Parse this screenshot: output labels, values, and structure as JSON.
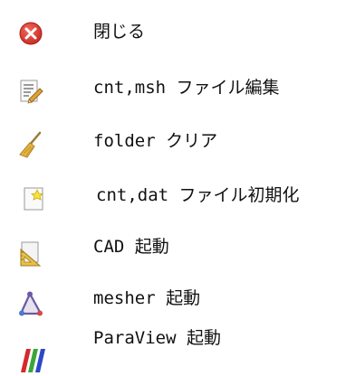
{
  "menu": {
    "items": [
      {
        "icon": "close-icon",
        "label": "閉じる"
      },
      {
        "icon": "edit-document-icon",
        "label": "cnt,msh ファイル編集"
      },
      {
        "icon": "broom-icon",
        "label": "folder クリア"
      },
      {
        "icon": "new-document-icon",
        "label": "cnt,dat ファイル初期化"
      },
      {
        "icon": "cad-drafting-icon",
        "label": "CAD 起動"
      },
      {
        "icon": "mesher-triangle-icon",
        "label": "mesher 起動"
      },
      {
        "icon": "paraview-icon",
        "label": "ParaView 起動"
      }
    ]
  },
  "colors": {
    "close_red": "#d9302a",
    "paraview_red": "#d52a2a",
    "paraview_green": "#3aa63a",
    "paraview_blue": "#2a48c8",
    "mesher_purple": "#6a5aa6"
  }
}
